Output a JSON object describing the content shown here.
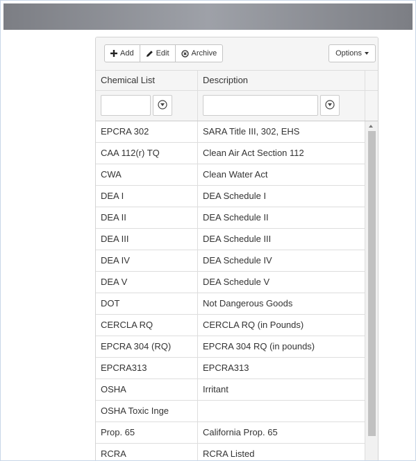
{
  "toolbar": {
    "add_label": "Add",
    "edit_label": "Edit",
    "archive_label": "Archive",
    "options_label": "Options"
  },
  "table": {
    "columns": [
      "Chemical List",
      "Description"
    ],
    "filters": [
      {
        "value": ""
      },
      {
        "value": ""
      }
    ],
    "rows": [
      [
        "EPCRA 302",
        "SARA Title III, 302, EHS"
      ],
      [
        "CAA 112(r) TQ",
        "Clean Air Act Section 112"
      ],
      [
        "CWA",
        "Clean Water Act"
      ],
      [
        "DEA I",
        "DEA Schedule I"
      ],
      [
        "DEA II",
        "DEA Schedule II"
      ],
      [
        "DEA III",
        "DEA Schedule III"
      ],
      [
        "DEA IV",
        "DEA Schedule IV"
      ],
      [
        "DEA V",
        "DEA Schedule V"
      ],
      [
        "DOT",
        "Not Dangerous Goods"
      ],
      [
        "CERCLA RQ",
        "CERCLA RQ (in Pounds)"
      ],
      [
        "EPCRA 304 (RQ)",
        "EPCRA 304 RQ (in pounds)"
      ],
      [
        "EPCRA313",
        "EPCRA313"
      ],
      [
        "OSHA",
        "Irritant"
      ],
      [
        "OSHA Toxic Inge",
        ""
      ],
      [
        "Prop. 65",
        "California Prop. 65"
      ],
      [
        "RCRA",
        "RCRA Listed"
      ]
    ]
  },
  "icons": {
    "add": "plus-icon",
    "edit": "pencil-icon",
    "archive": "circle-x-icon",
    "filter": "filter-icon",
    "options": "caret-down-icon"
  },
  "colors": {
    "topbar": "#8e9096",
    "toolbar_bg": "#f5f5f5",
    "border": "#dddddd",
    "frame_border": "#c8d6e8"
  }
}
